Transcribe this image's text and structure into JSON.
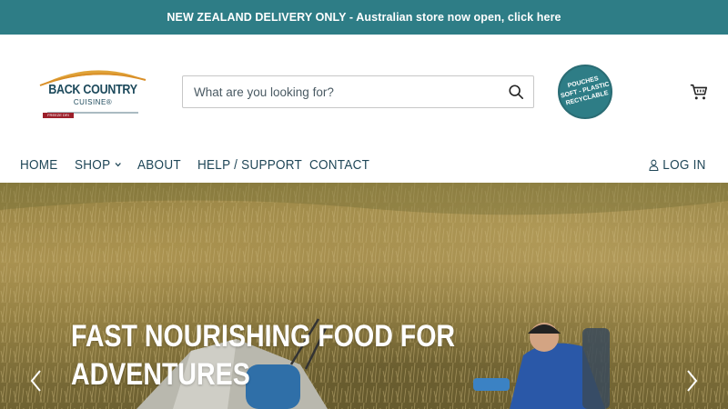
{
  "announcement": {
    "text": "NEW ZEALAND DELIVERY ONLY - Australian store now open, click here"
  },
  "logo": {
    "name": "BACK COUNTRY",
    "sub": "CUISINE®",
    "tag": "FREEZE DRI"
  },
  "search": {
    "placeholder": "What are you looking for?",
    "value": ""
  },
  "badge": {
    "lines": [
      "POUCHES",
      "SOFT - PLASTIC",
      "RECYCLABLE"
    ]
  },
  "nav": {
    "items": [
      {
        "label": "HOME"
      },
      {
        "label": "SHOP"
      },
      {
        "label": "ABOUT"
      },
      {
        "label": "HELP / SUPPORT"
      },
      {
        "label": "CONTACT"
      }
    ],
    "login_label": "LOG IN"
  },
  "hero": {
    "title_line1": "FAST NOURISHING FOOD FOR",
    "title_line2": "ADVENTURES"
  },
  "colors": {
    "brand_teal": "#2e7d86",
    "nav_text": "#1f4657",
    "logo_red": "#9c1f2a",
    "logo_gold": "#e0a43a"
  },
  "icons": {
    "search": "search-icon",
    "cart": "cart-icon",
    "login": "user-icon",
    "prev": "chevron-left-icon",
    "next": "chevron-right-icon",
    "shop_dropdown": "chevron-down-icon"
  }
}
